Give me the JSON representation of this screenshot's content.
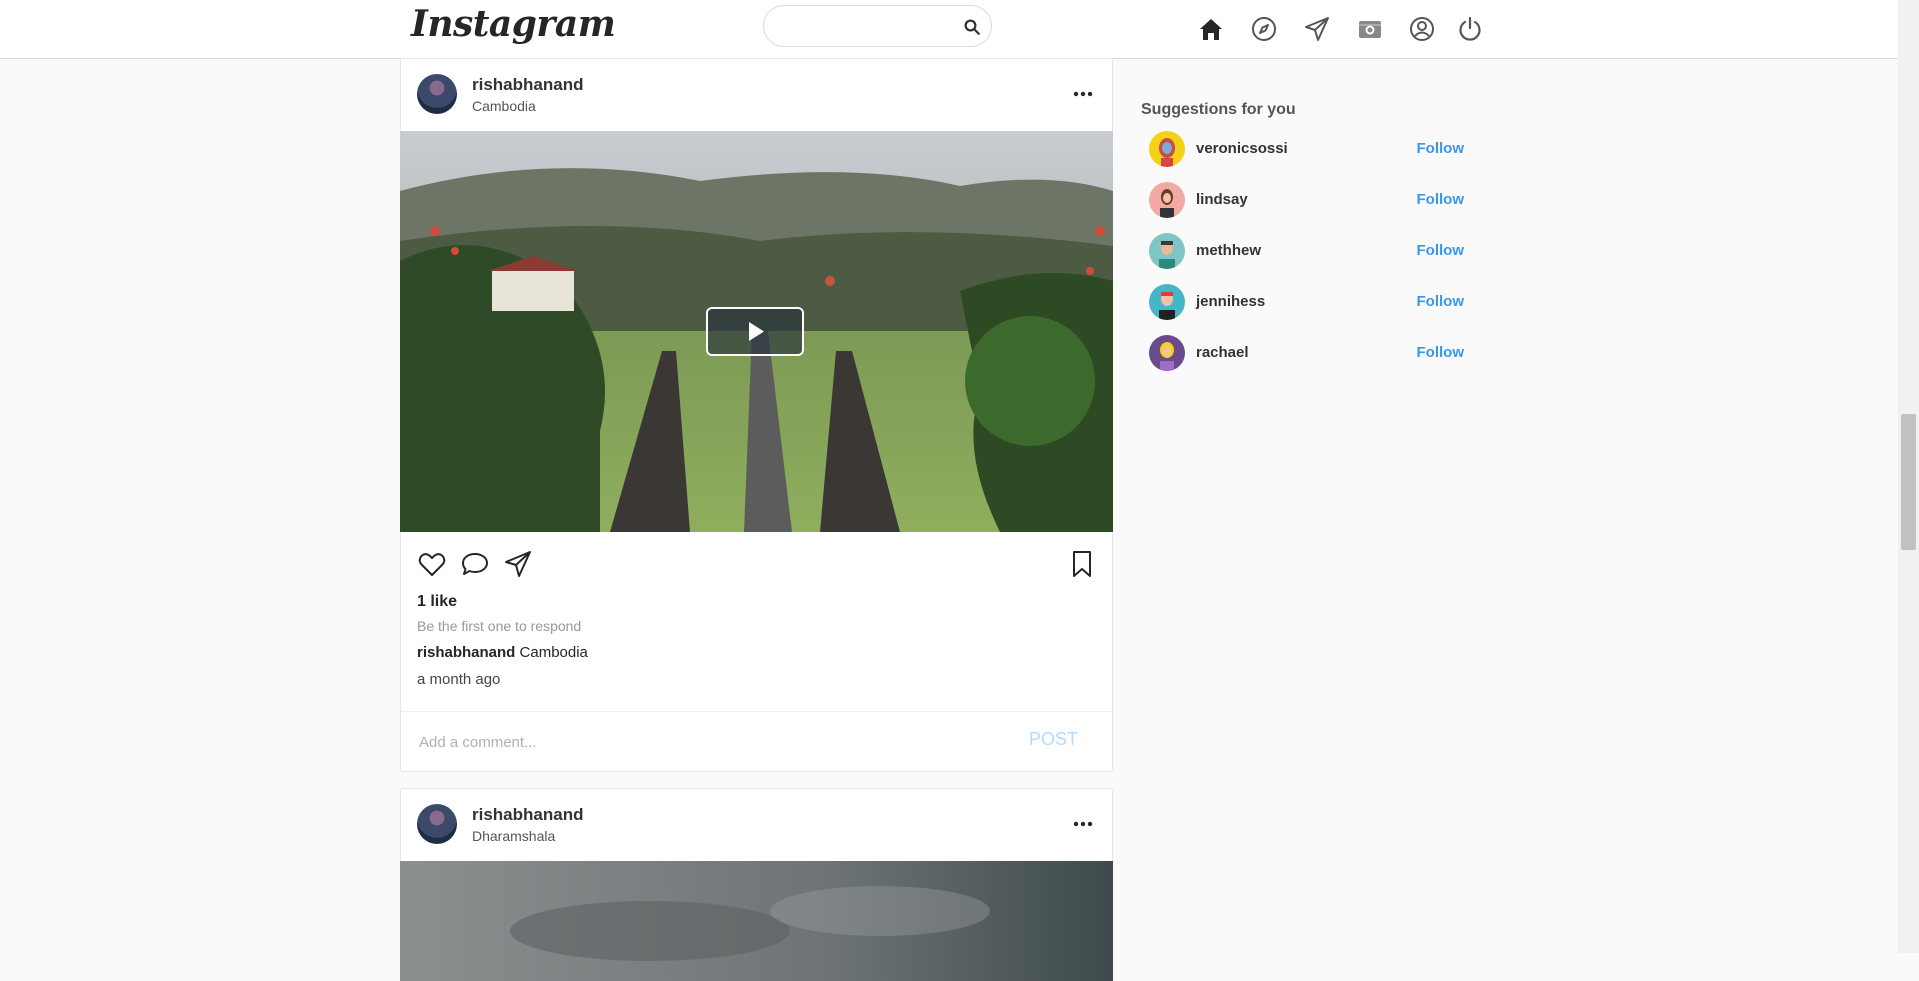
{
  "header": {
    "logo": "Instagram",
    "search": {
      "placeholder": "",
      "value": ""
    },
    "nav": [
      "home-icon",
      "explore-icon",
      "direct-icon",
      "camera-icon",
      "profile-icon",
      "logout-icon"
    ]
  },
  "posts": [
    {
      "username": "rishabhanand",
      "location": "Cambodia",
      "media": "video",
      "likes": "1 like",
      "respond_hint": "Be the first one to respond",
      "caption_user": "rishabhanand",
      "caption_text": "Cambodia",
      "time": "a month ago",
      "comment_placeholder": "Add a comment...",
      "post_label": "POST"
    },
    {
      "username": "rishabhanand",
      "location": "Dharamshala"
    }
  ],
  "suggestions": {
    "title": "Suggestions for you",
    "follow_label": "Follow",
    "users": [
      {
        "name": "veronicsossi",
        "color": "#f5d218"
      },
      {
        "name": "lindsay",
        "color": "#f2a9a4"
      },
      {
        "name": "methhew",
        "color": "#7fc5c6"
      },
      {
        "name": "jennihess",
        "color": "#44b6c7"
      },
      {
        "name": "rachael",
        "color": "#6b4a8c"
      }
    ]
  },
  "colors": {
    "accent": "#3897f0",
    "post_disabled": "#b3dbff"
  }
}
